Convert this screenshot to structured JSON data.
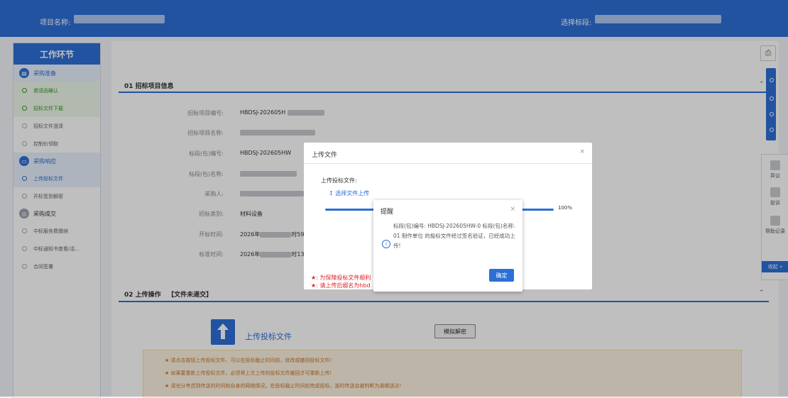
{
  "header": {
    "project_label": "项目名称:",
    "bid_label": "选择标段:"
  },
  "sidebar": {
    "title": "工作环节",
    "groups": [
      {
        "label": "采购准备",
        "items": [
          "邀请函确认",
          "招标文件下载",
          "招标文件澄清",
          "控制价领取"
        ]
      },
      {
        "label": "采购响应",
        "items": [
          "上传投标文件",
          "开标签到解密"
        ]
      },
      {
        "label": "采购成交",
        "items": [
          "中标服务费缴纳",
          "中标通知书查看/活...",
          "合同签署"
        ]
      }
    ]
  },
  "main": {
    "section1_title": "01 招标项目信息",
    "fields": [
      {
        "label": "招标项目编号:",
        "value": "HBDSJ-202605H"
      },
      {
        "label": "招标项目名称:",
        "value": ""
      },
      {
        "label": "标段(包)编号:",
        "value": "HBDSJ-202605HW"
      },
      {
        "label": "标段(包)名称:",
        "value": ""
      },
      {
        "label": "采购人:",
        "value": ""
      },
      {
        "label": "招标类别:",
        "value": "材料设备"
      },
      {
        "label": "开标时间:",
        "value": "2026年",
        "suffix": "时59"
      },
      {
        "label": "标准时间:",
        "value": "2026年",
        "suffix": "时13"
      }
    ],
    "section2_title": "02 上传操作",
    "section2_status": "【文件未递交】",
    "upload_label": "上传投标文件",
    "mock_decrypt": "模拟解密",
    "notices": [
      "★ 请点击按钮上传投标文件，可以在投标截止时间前，修改或撤回投标文件!",
      "★ 如果要重新上传投标文件，必须将上次上传的投标文件撤回才可重新上传!",
      "★ 请充分考虑到传送的时间和自身的网络情况，在投标截止时间前完成投标，逾时传送会被判断为逾期送达!"
    ]
  },
  "right_panel": {
    "items": [
      "异议",
      "投诉",
      "帮助记录"
    ],
    "collapse": "收起 »"
  },
  "upload_dialog": {
    "title": "上传文件",
    "close": "×",
    "file_label": "上传投标文件:",
    "select_link": "↥ 选择文件上传",
    "progress": 100,
    "progress_label": "100%",
    "warn1": "★: 为保障投标文件顺利",
    "warn2": "★: 请上传后缀名为hbd"
  },
  "alert_dialog": {
    "title": "提醒",
    "close": "×",
    "message": "标段(包)编号: HBDSJ-202605HW-0         标段(包)名称:                  01 制作单位            的投标文件经过签名验证，已经成功上传!",
    "ok": "确定"
  },
  "colors": {
    "primary": "#2d6fd6",
    "notice_text": "#c8742b",
    "warn": "#e02020"
  }
}
